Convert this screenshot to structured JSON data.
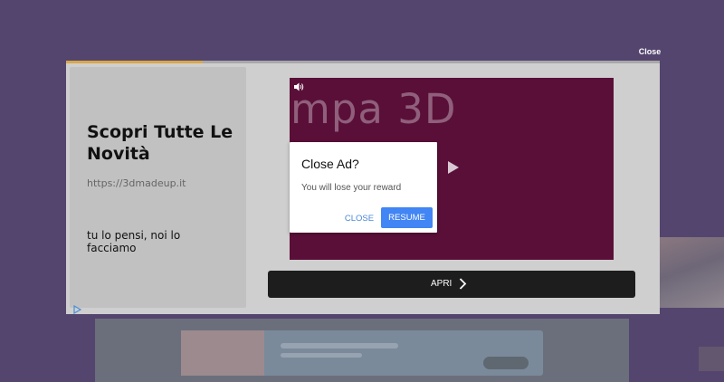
{
  "overlay": {
    "close_label": "Close"
  },
  "ad": {
    "progress_fraction": 0.23,
    "headline": "Scopri Tutte Le Novità",
    "url": "https://3dmadeup.it",
    "description": "tu lo pensi, noi lo facciamo",
    "video": {
      "title_text": "mpa 3D",
      "background_color": "#5a0f38"
    },
    "cta_label": "APRI",
    "icons": {
      "volume": "volume-icon",
      "play": "play-icon",
      "chevron": "chevron-right-icon",
      "adchoices": "adchoices-icon"
    }
  },
  "dialog": {
    "title": "Close Ad?",
    "message": "You will lose your reward",
    "close_label": "CLOSE",
    "resume_label": "RESUME",
    "accent_color": "#4285f4"
  }
}
